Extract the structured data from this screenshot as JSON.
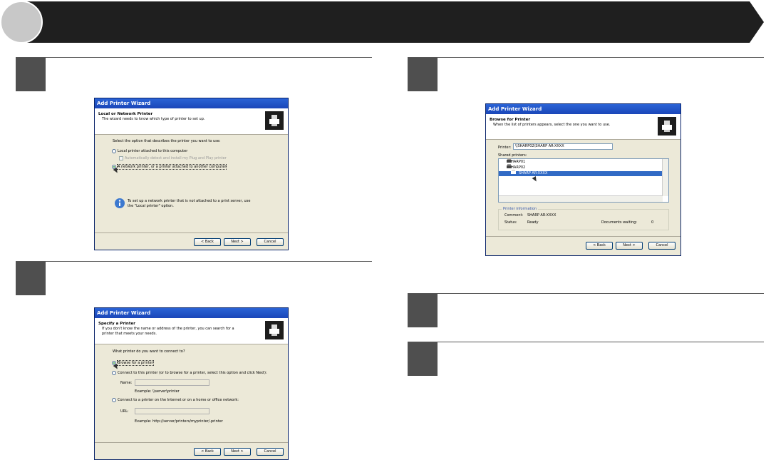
{
  "colors": {
    "banner": "#1f1f1f",
    "step_box": "#4f4f4f",
    "circle": "#c8c8c8"
  },
  "dialog1": {
    "title": "Add Printer Wizard",
    "header_title": "Local or Network Printer",
    "header_sub": "The wizard needs to know which type of printer to set up.",
    "prompt": "Select the option that describes the printer you want to use:",
    "option_local": "Local printer attached to this computer",
    "option_auto": "Automatically detect and install my Plug and Play printer",
    "option_network": "A network printer, or a printer attached to another computer",
    "info": "To set up a network printer that is not attached to a print server, use the \"Local printer\" option.",
    "back": "< Back",
    "next": "Next >",
    "cancel": "Cancel"
  },
  "dialog2": {
    "title": "Add Printer Wizard",
    "header_title": "Specify a Printer",
    "header_sub": "If you don't know the name or address of the printer, you can search for a printer that meets your needs.",
    "prompt": "What printer do you want to connect to?",
    "option_browse": "Browse for a printer",
    "option_connect": "Connect to this printer (or to browse for a printer, select this option and click Next):",
    "name_label": "Name:",
    "name_example": "Example: \\\\server\\printer",
    "option_internet": "Connect to a printer on the Internet or on a home or office network:",
    "url_label": "URL:",
    "url_example": "Example: http://server/printers/myprinter/.printer",
    "back": "< Back",
    "next": "Next >",
    "cancel": "Cancel"
  },
  "dialog3": {
    "title": "Add Printer Wizard",
    "header_title": "Browse for Printer",
    "header_sub": "When the list of printers appears, select the one you want to use.",
    "printer_label": "Printer:",
    "printer_value": "\\\\SHARP02\\SHARP AR-XXXX",
    "shared_label": "Shared printers:",
    "items": [
      "SHARP01",
      "SHARP02",
      "SHARP AR-XXXX"
    ],
    "info_group": "Printer information",
    "comment_label": "Comment:",
    "comment_value": "SHARP AR-XXXX",
    "status_label": "Status:",
    "status_value": "Ready",
    "docs_label": "Documents waiting:",
    "docs_value": "0",
    "back": "< Back",
    "next": "Next >",
    "cancel": "Cancel"
  }
}
